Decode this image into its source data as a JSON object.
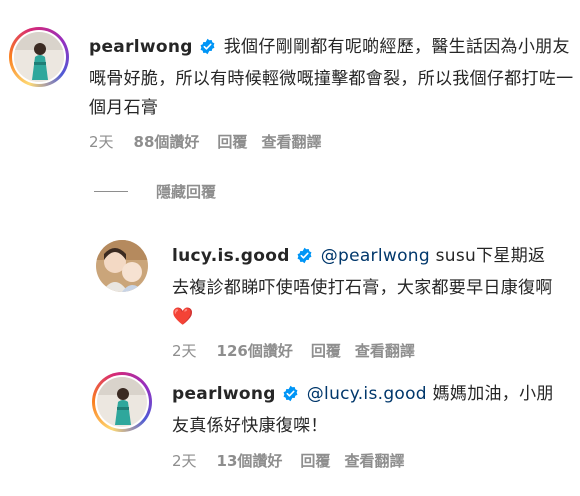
{
  "comments": [
    {
      "username": "pearlwong",
      "text": "我個仔剛剛都有呢啲經歷，醫生話因為小朋友嘅骨好脆，所以有時候輕微嘅撞擊都會裂，所以我個仔都打咗一個月石膏",
      "mention": "",
      "time": "2天",
      "likes": "88個讚好",
      "reply": "回覆",
      "translate": "查看翻譯"
    },
    {
      "username": "lucy.is.good",
      "mention": "@pearlwong",
      "text": " susu下星期返去複診都睇吓使唔使打石膏，大家都要早日康復啊❤️",
      "time": "2天",
      "likes": "126個讚好",
      "reply": "回覆",
      "translate": "查看翻譯"
    },
    {
      "username": "pearlwong",
      "mention": "@lucy.is.good",
      "text": " 媽媽加油，小朋友真係好快康復㗎！",
      "time": "2天",
      "likes": "13個讚好",
      "reply": "回覆",
      "translate": "查看翻譯"
    }
  ],
  "hide_replies_label": "隱藏回覆",
  "colors": {
    "verified": "#0095f6",
    "mention": "#00376b",
    "meta": "#8e8e8e"
  }
}
